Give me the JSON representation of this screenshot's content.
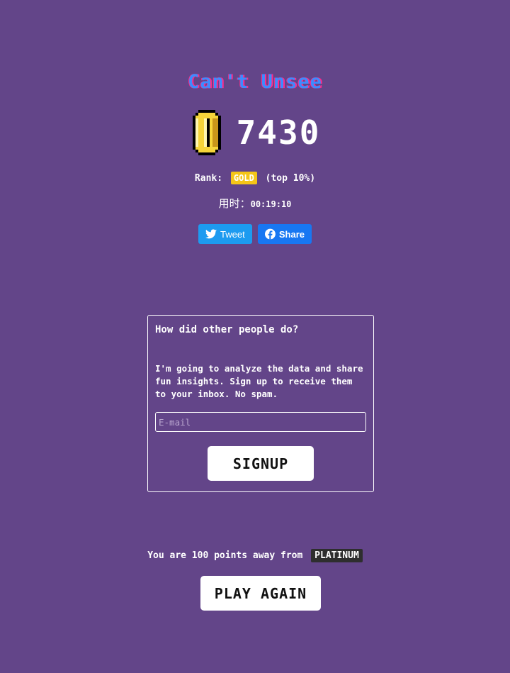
{
  "game": {
    "title": "Can't Unsee",
    "score": "7430",
    "rank_label": "Rank:",
    "rank_badge": "GOLD",
    "rank_detail": "(top 10%)",
    "time_label": "用时：",
    "time_value": "00:19:10",
    "gold_color": "#f5c518",
    "icons": [
      "coin-icon",
      "twitter-bird-icon",
      "facebook-icon"
    ]
  },
  "share": {
    "tweet_label": "Tweet",
    "share_label": "Share"
  },
  "signup_card": {
    "heading": "How did other people do?",
    "body": "I'm going to analyze the data and share fun insights. Sign up to receive them to your inbox. No spam.",
    "email_placeholder": "E-mail",
    "email_value": "",
    "button_label": "SIGNUP"
  },
  "next_rank": {
    "text": "You are 100 points away from",
    "badge": "PLATINUM",
    "play_again_label": "PLAY AGAIN"
  }
}
